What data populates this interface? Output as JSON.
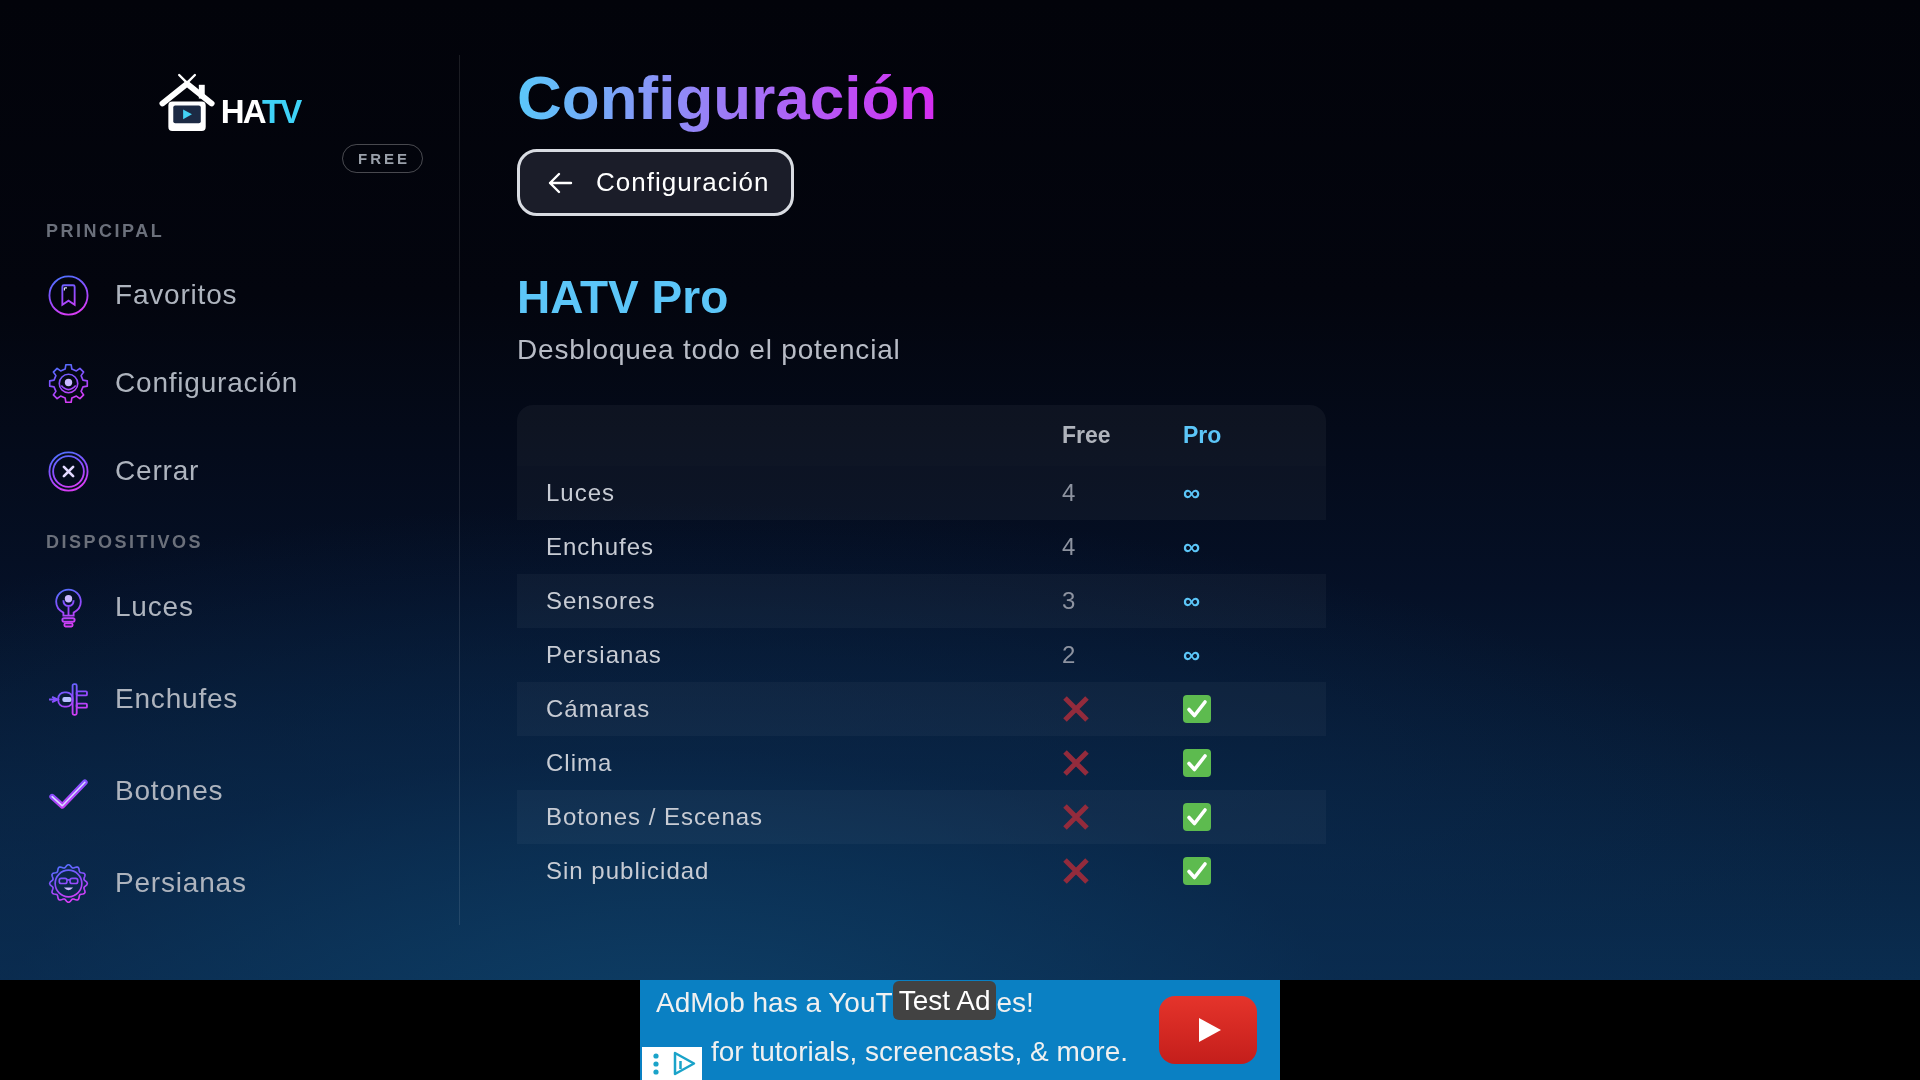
{
  "sidebar": {
    "logo": {
      "parts": [
        "HA",
        "TV"
      ]
    },
    "plan_badge": "FREE",
    "sections": [
      {
        "title": "PRINCIPAL",
        "items": [
          {
            "label": "Favoritos",
            "selected": false
          },
          {
            "label": "Configuración",
            "selected": false
          },
          {
            "label": "Cerrar",
            "selected": false
          }
        ]
      },
      {
        "title": "DISPOSITIVOS",
        "items": [
          {
            "label": "Luces",
            "selected": false
          },
          {
            "label": "Enchufes",
            "selected": false
          },
          {
            "label": "Botones",
            "selected": false
          },
          {
            "label": "Persianas",
            "selected": false
          }
        ]
      }
    ]
  },
  "page_title": "Configuración",
  "back_button": {
    "label": "Configuración"
  },
  "plan": {
    "title": "HATV Pro",
    "subtitle": "Desbloquea todo el potencial"
  },
  "comparison_table": {
    "columns": [
      {
        "label": "Free",
        "highlighted": false
      },
      {
        "label": "Pro",
        "highlighted": true
      }
    ],
    "rows": [
      {
        "label": "Luces",
        "values": [
          {
            "kind": "text",
            "text": "4"
          },
          {
            "kind": "text",
            "text": "∞"
          }
        ]
      },
      {
        "label": "Enchufes",
        "values": [
          {
            "kind": "text",
            "text": "4"
          },
          {
            "kind": "text",
            "text": "∞"
          }
        ]
      },
      {
        "label": "Sensores",
        "values": [
          {
            "kind": "text",
            "text": "3"
          },
          {
            "kind": "text",
            "text": "∞"
          }
        ]
      },
      {
        "label": "Persianas",
        "values": [
          {
            "kind": "text",
            "text": "2"
          },
          {
            "kind": "text",
            "text": "∞"
          }
        ]
      },
      {
        "label": "Cámaras",
        "values": [
          {
            "kind": "mark",
            "available": false
          },
          {
            "kind": "mark",
            "available": true
          }
        ]
      },
      {
        "label": "Clima",
        "values": [
          {
            "kind": "mark",
            "available": false
          },
          {
            "kind": "mark",
            "available": true
          }
        ]
      },
      {
        "label": "Botones / Escenas",
        "values": [
          {
            "kind": "mark",
            "available": false
          },
          {
            "kind": "mark",
            "available": true
          }
        ]
      },
      {
        "label": "Sin publicidad",
        "values": [
          {
            "kind": "mark",
            "available": false
          },
          {
            "kind": "mark",
            "available": true
          }
        ]
      }
    ]
  },
  "ad_banner": {
    "badge": "Test Ad",
    "headline_visible_parts": [
      "AdMob has a YouT",
      "es!"
    ],
    "line_2_visible": "for tutorials, screencasts, & more."
  }
}
